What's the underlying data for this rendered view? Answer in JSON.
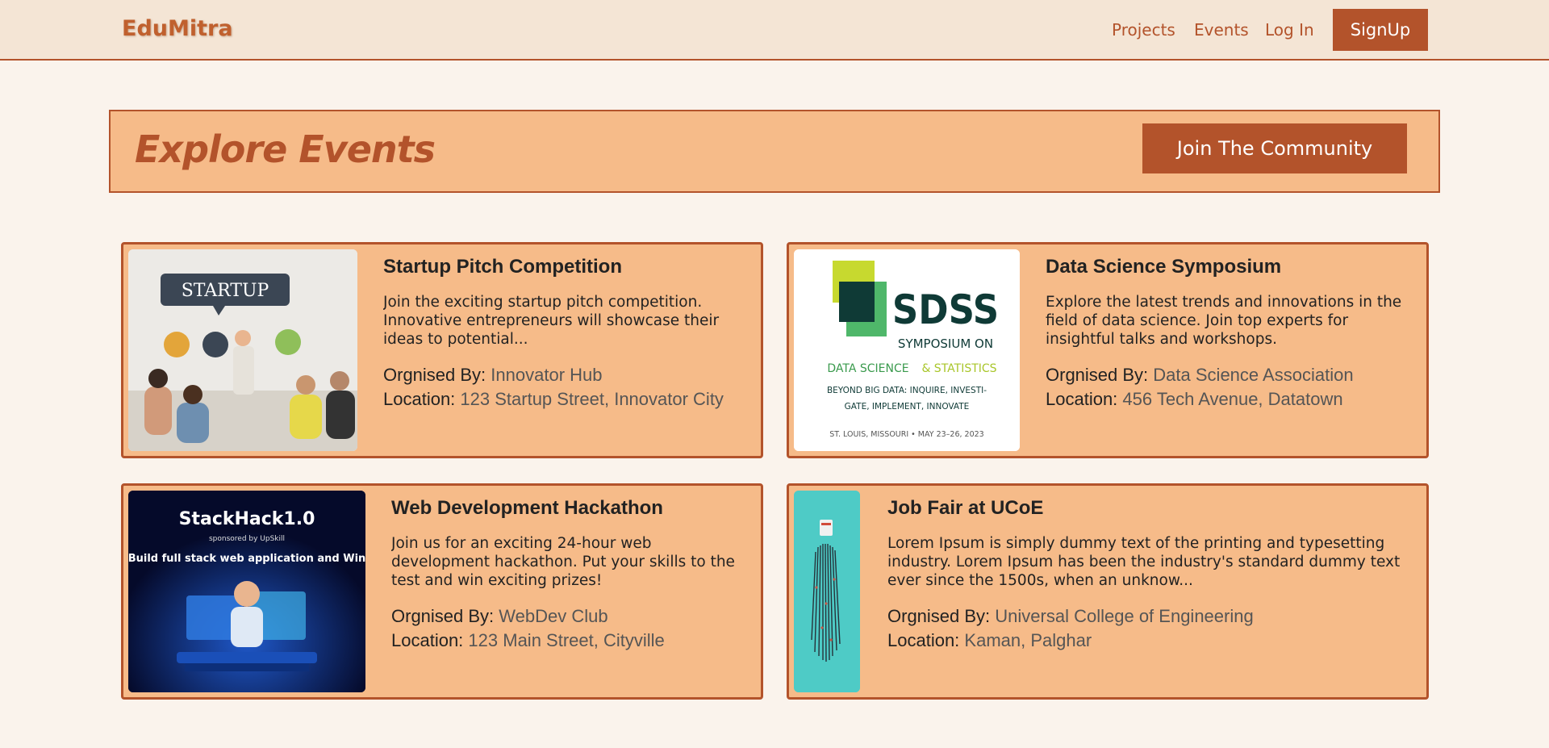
{
  "navbar": {
    "brand": "EduMitra",
    "links": [
      "Projects",
      "Events",
      "Log In"
    ],
    "signup_label": "SignUp"
  },
  "banner": {
    "title": "Explore Events",
    "button_label": "Join The Community"
  },
  "labels": {
    "organised_by": "Orgnised By:",
    "location": "Location:"
  },
  "events": [
    {
      "title": "Startup Pitch Competition",
      "description": "Join the exciting startup pitch competition. Innovative entrepreneurs will showcase their ideas to potential...",
      "organiser": "Innovator Hub",
      "location": "123 Startup Street, Innovator City",
      "image_text": "STARTUP"
    },
    {
      "title": "Data Science Symposium",
      "description": "Explore the latest trends and innovations in the field of data science. Join top experts for insightful talks and workshops.",
      "organiser": "Data Science Association",
      "location": "456 Tech Avenue, Datatown",
      "image_text": {
        "acronym": "SDSS",
        "line1": "SYMPOSIUM ON",
        "line2a": "DATA SCIENCE",
        "line2b": "& STATISTICS",
        "line3": "BEYOND BIG DATA: INQUIRE, INVESTI-",
        "line4": "GATE, IMPLEMENT, INNOVATE",
        "line5": "ST. LOUIS, MISSOURI • MAY 23–26, 2023"
      }
    },
    {
      "title": "Web Development Hackathon",
      "description": "Join us for an exciting 24-hour web development hackathon. Put your skills to the test and win exciting prizes!",
      "organiser": "WebDev Club",
      "location": "123 Main Street, Cityville",
      "image_text": {
        "name": "StackHack1.0",
        "sponsor": "sponsored by UpSkill",
        "tagline": "Build full stack web application and Win"
      }
    },
    {
      "title": "Job Fair at UCoE",
      "description": "Lorem Ipsum is simply dummy text of the printing and typesetting industry. Lorem Ipsum has been the industry's standard dummy text ever since the 1500s, when an unknow...",
      "organiser": "Universal College of Engineering",
      "location": "Kaman, Palghar"
    }
  ]
}
